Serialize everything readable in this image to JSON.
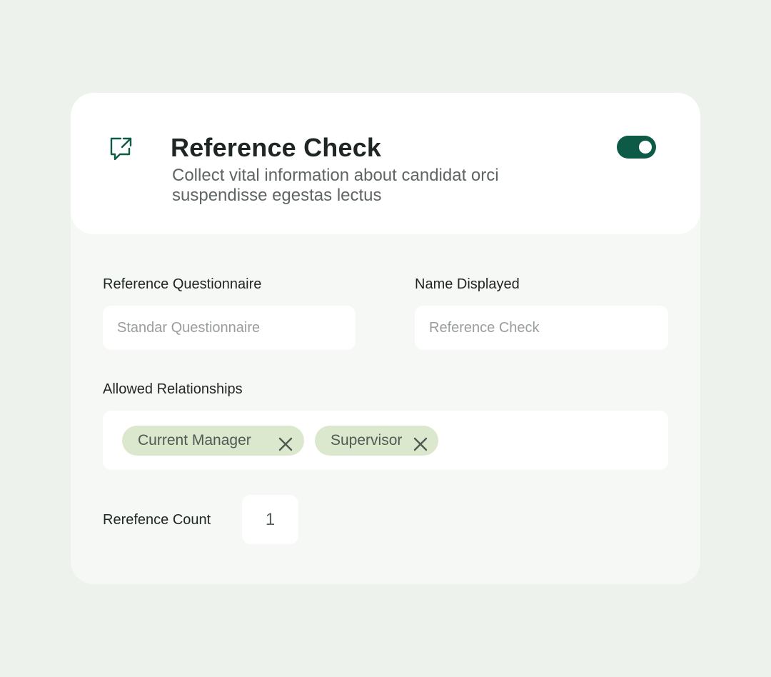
{
  "header": {
    "icon": "external-message-icon",
    "title": "Reference Check",
    "subtitle_line1": "Collect vital information about candidat orci",
    "subtitle_line2": "suspendisse egestas lectus",
    "toggle_on": true
  },
  "form": {
    "questionnaire": {
      "label": "Reference Questionnaire",
      "placeholder": "Standar Questionnaire"
    },
    "name_displayed": {
      "label": "Name Displayed",
      "placeholder": "Reference Check"
    },
    "relationships": {
      "label": "Allowed Relationships",
      "tags": [
        "Current Manager",
        "Supervisor"
      ]
    },
    "reference_count": {
      "label": "Rerefence Count",
      "value": "1"
    }
  },
  "colors": {
    "background": "#edf2ec",
    "card": "#f5f8f4",
    "accent": "#0d5a46",
    "tag": "#dce8cd"
  }
}
